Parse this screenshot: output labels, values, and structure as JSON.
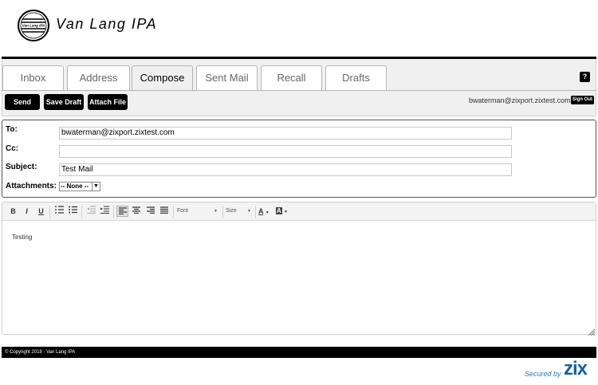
{
  "header": {
    "title": "Van Lang IPA",
    "logo_text": "Van Lang IPA"
  },
  "tabs": [
    {
      "label": "Inbox",
      "active": false
    },
    {
      "label": "Address",
      "active": false
    },
    {
      "label": "Compose",
      "active": true
    },
    {
      "label": "Sent Mail",
      "active": false
    },
    {
      "label": "Recall",
      "active": false
    },
    {
      "label": "Drafts",
      "active": false
    }
  ],
  "help": {
    "label": "?"
  },
  "actions": {
    "send": "Send",
    "save_draft": "Save Draft",
    "attach_file": "Attach File"
  },
  "user": {
    "email": "bwaterman@zixport.zixtest.com",
    "sign_out": "Sign Out"
  },
  "form": {
    "to_label": "To:",
    "to_value": "bwaterman@zixport.zixtest.com",
    "cc_label": "Cc:",
    "cc_value": "",
    "subject_label": "Subject:",
    "subject_value": "Test Mail",
    "attachments_label": "Attachments:",
    "attachments_selected": "-- None --"
  },
  "toolbar": {
    "bold": "B",
    "italic": "I",
    "underline": "U",
    "font_label": "Font",
    "size_label": "Size",
    "text_color": "A",
    "bg_color": "A"
  },
  "editor": {
    "body": "Testing"
  },
  "footer": {
    "copyright": "© Copyright 2018 - Van Lang IPA"
  },
  "security_badge": {
    "text": "Secured by",
    "brand": "zix"
  },
  "colors": {
    "accent": "#000000",
    "panel": "#f0f0f0",
    "brand": "#0f63a8"
  }
}
